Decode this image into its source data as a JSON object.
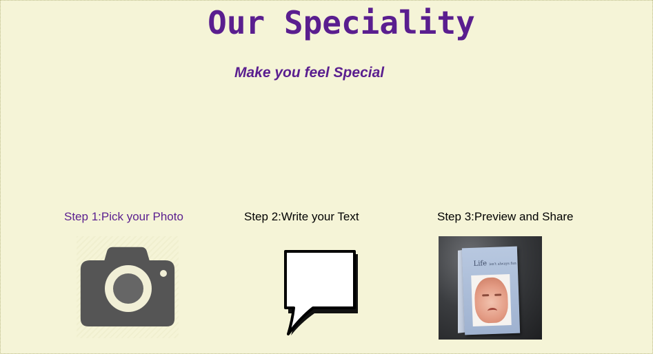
{
  "header": {
    "title": "Our Speciality",
    "subtitle": "Make you feel Special"
  },
  "steps": [
    {
      "label": "Step 1:Pick your Photo",
      "icon": "camera-icon",
      "active": true
    },
    {
      "label": "Step 2:Write your Text",
      "icon": "speech-bubble-icon",
      "active": false
    },
    {
      "label": "Step 3:Preview and Share",
      "icon": "card-preview-photo",
      "active": false
    }
  ],
  "preview_card": {
    "text_main": "Life",
    "text_small": "isn't always fun"
  },
  "colors": {
    "background": "#f5f4d7",
    "accent": "#5a1e8f",
    "text": "#000000",
    "icon_gray": "#555555"
  }
}
